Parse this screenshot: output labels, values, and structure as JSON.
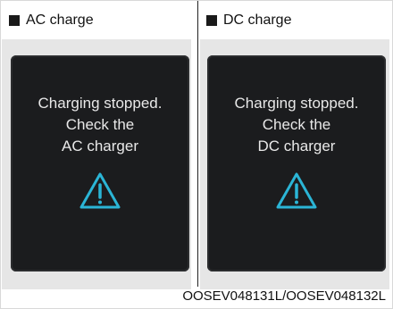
{
  "panels": [
    {
      "heading": "AC charge",
      "message_lines": [
        "Charging stopped.",
        "Check the",
        "AC charger"
      ],
      "icon": "warning-triangle-icon"
    },
    {
      "heading": "DC charge",
      "message_lines": [
        "Charging stopped.",
        "Check the",
        "DC charger"
      ],
      "icon": "warning-triangle-icon"
    }
  ],
  "caption": "OOSEV048131L/OOSEV048132L",
  "colors": {
    "screen_bg": "#1b1c1e",
    "message_text": "#e8e8e8",
    "warning_icon": "#2bb5d6"
  }
}
